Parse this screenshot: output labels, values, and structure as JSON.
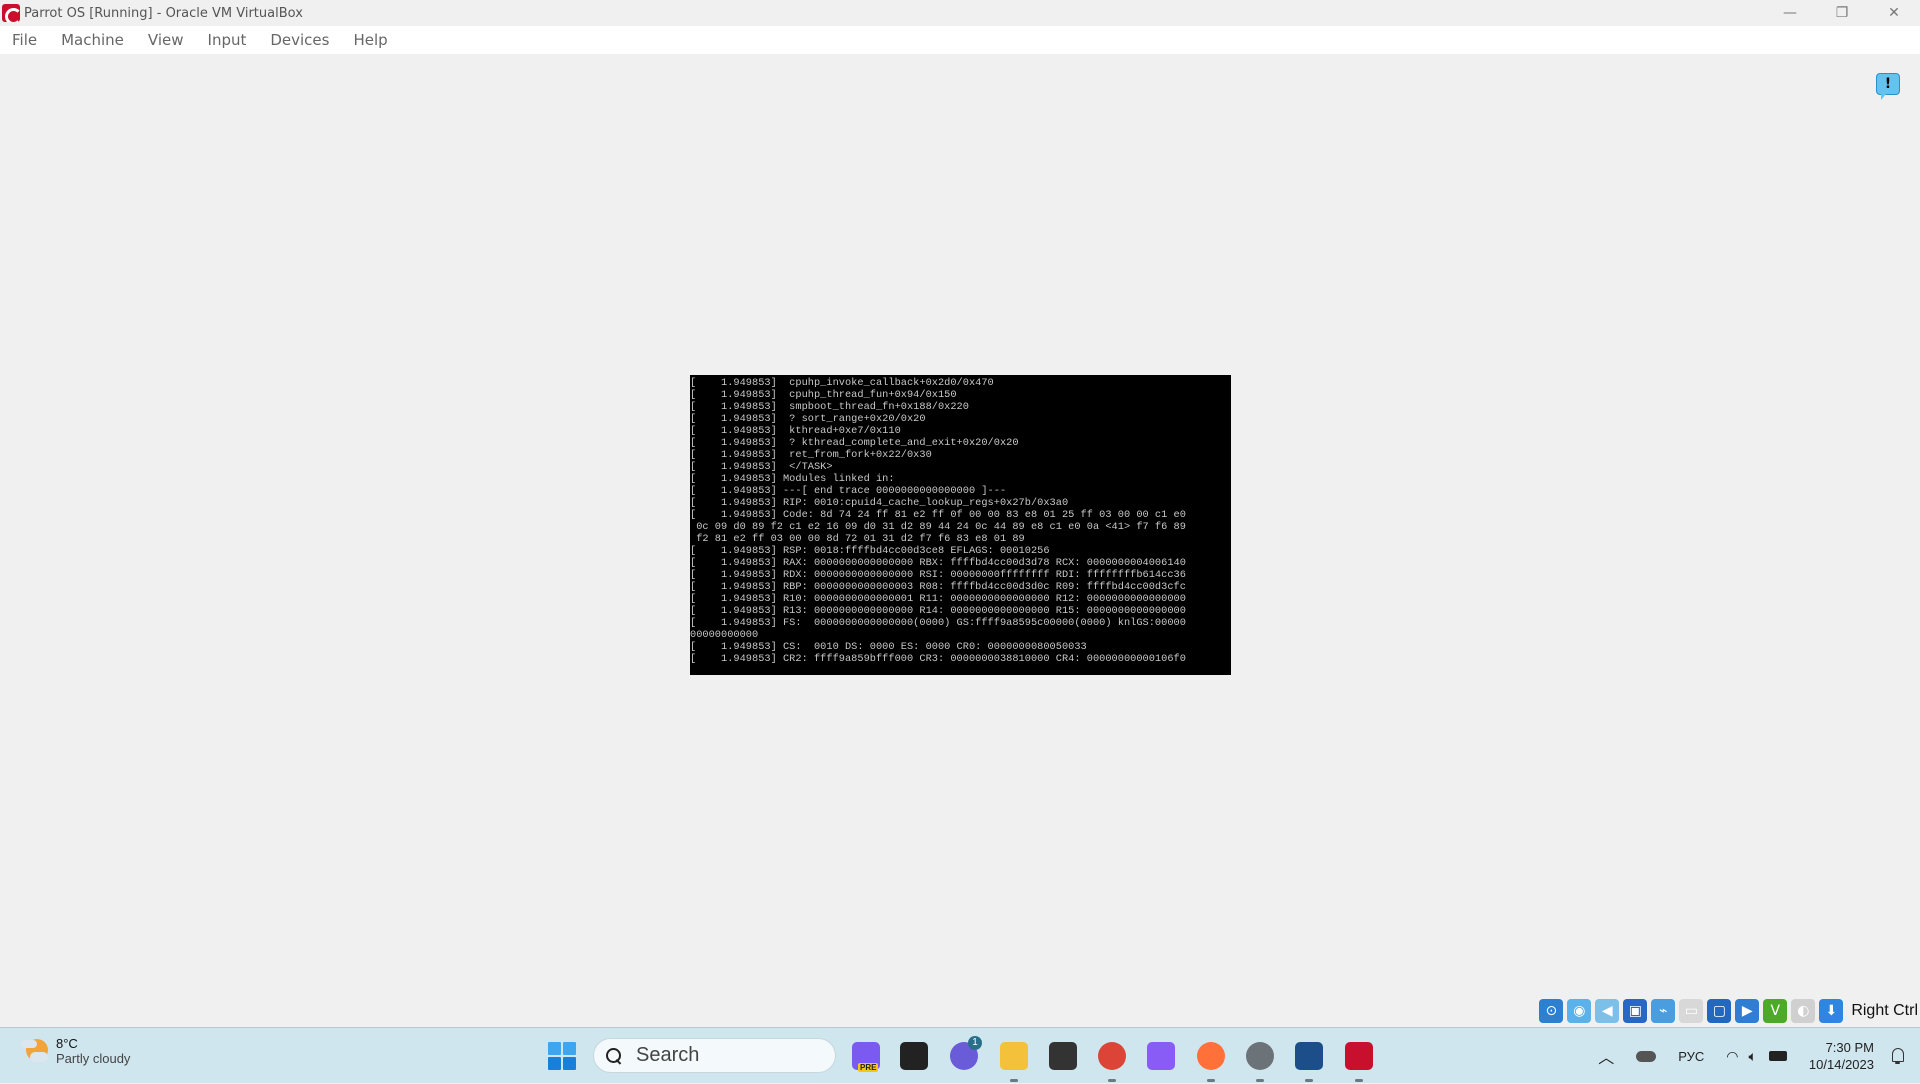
{
  "window": {
    "title": "Parrot OS [Running] - Oracle VM VirtualBox",
    "app_icon": "parrot-os-icon",
    "controls": [
      {
        "name": "minimize",
        "icon": "minimize-icon",
        "glyph": "—"
      },
      {
        "name": "restore",
        "icon": "restore-icon",
        "glyph": "❐"
      },
      {
        "name": "close",
        "icon": "close-icon",
        "glyph": "✕"
      }
    ]
  },
  "menu": {
    "items": [
      {
        "label": "File"
      },
      {
        "label": "Machine"
      },
      {
        "label": "View"
      },
      {
        "label": "Input"
      },
      {
        "label": "Devices"
      },
      {
        "label": "Help"
      }
    ]
  },
  "notification": {
    "icon": "notification-exclamation-icon",
    "glyph": "!"
  },
  "console": {
    "lines": [
      "[    1.949853]  cpuhp_invoke_callback+0x2d0/0x470",
      "[    1.949853]  cpuhp_thread_fun+0x94/0x150",
      "[    1.949853]  smpboot_thread_fn+0x188/0x220",
      "[    1.949853]  ? sort_range+0x20/0x20",
      "[    1.949853]  kthread+0xe7/0x110",
      "[    1.949853]  ? kthread_complete_and_exit+0x20/0x20",
      "[    1.949853]  ret_from_fork+0x22/0x30",
      "[    1.949853]  </TASK>",
      "[    1.949853] Modules linked in:",
      "[    1.949853] ---[ end trace 0000000000000000 ]---",
      "[    1.949853] RIP: 0010:cpuid4_cache_lookup_regs+0x27b/0x3a0",
      "[    1.949853] Code: 8d 74 24 ff 81 e2 ff 0f 00 00 83 e8 01 25 ff 03 00 00 c1 e0",
      " 0c 09 d0 89 f2 c1 e2 16 09 d0 31 d2 89 44 24 0c 44 89 e8 c1 e0 0a <41> f7 f6 89",
      " f2 81 e2 ff 03 00 00 8d 72 01 31 d2 f7 f6 83 e8 01 89",
      "[    1.949853] RSP: 0018:ffffbd4cc00d3ce8 EFLAGS: 00010256",
      "[    1.949853] RAX: 0000000000000000 RBX: ffffbd4cc00d3d78 RCX: 0000000004006140",
      "[    1.949853] RDX: 0000000000000000 RSI: 00000000ffffffff RDI: ffffffffb614cc36",
      "[    1.949853] RBP: 0000000000000003 R08: ffffbd4cc00d3d0c R09: ffffbd4cc00d3cfc",
      "[    1.949853] R10: 0000000000000001 R11: 0000000000000000 R12: 0000000000000000",
      "[    1.949853] R13: 0000000000000000 R14: 0000000000000000 R15: 0000000000000000",
      "[    1.949853] FS:  0000000000000000(0000) GS:ffff9a8595c00000(0000) knlGS:00000",
      "00000000000",
      "[    1.949853] CS:  0010 DS: 0000 ES: 0000 CR0: 0000000080050033",
      "[    1.949853] CR2: ffff9a859bfff000 CR3: 0000000038810000 CR4: 00000000000106f0"
    ]
  },
  "statusbar": {
    "icons": [
      {
        "name": "hard-disk-icon",
        "color": "#2d7fd0",
        "glyph": "⊙"
      },
      {
        "name": "optical-drive-icon",
        "color": "#5bb2ea",
        "glyph": "◉"
      },
      {
        "name": "audio-icon",
        "color": "#7cc0ea",
        "glyph": "◀"
      },
      {
        "name": "network-icon",
        "color": "#2668c4",
        "glyph": "▣"
      },
      {
        "name": "usb-icon",
        "color": "#4a9ee0",
        "glyph": "⌁"
      },
      {
        "name": "shared-folders-icon",
        "color": "#d8d8d8",
        "glyph": "▭"
      },
      {
        "name": "display-icon",
        "color": "#2368c0",
        "glyph": "▢"
      },
      {
        "name": "video-capture-icon",
        "color": "#2f7ed3",
        "glyph": "▶"
      },
      {
        "name": "cpu-execution-icon",
        "color": "#4caa28",
        "glyph": "V"
      },
      {
        "name": "mouse-integration-icon",
        "color": "#d0d0d0",
        "glyph": "◐"
      },
      {
        "name": "keyboard-capture-icon",
        "color": "#2f86e0",
        "glyph": "⬇"
      }
    ],
    "host_key": "Right Ctrl"
  },
  "taskbar": {
    "weather": {
      "temp": "8°C",
      "desc": "Partly cloudy",
      "icon": "weather-partly-cloudy-night-icon"
    },
    "start_icon": "windows-start-icon",
    "search_placeholder": "Search",
    "apps": [
      {
        "name": "copilot-icon",
        "badge": "PRE",
        "color": "#7a5af0"
      },
      {
        "name": "task-view-icon",
        "color": "#222"
      },
      {
        "name": "teams-chat-icon",
        "badge": "1",
        "color": "#6a5bd8"
      },
      {
        "name": "file-explorer-icon",
        "color": "#f3c13a",
        "running": true
      },
      {
        "name": "terminal-icon",
        "color": "#333"
      },
      {
        "name": "chrome-icon",
        "color": "#db4437",
        "running": true
      },
      {
        "name": "obsidian-icon",
        "color": "#8a5cf6"
      },
      {
        "name": "firefox-icon",
        "color": "#ff7139",
        "running": true
      },
      {
        "name": "settings-icon",
        "color": "#6b7379",
        "running": true
      },
      {
        "name": "virtualbox-icon",
        "color": "#1c4f8a",
        "running": true
      },
      {
        "name": "parrot-vm-icon",
        "color": "#c8102e",
        "running": true
      }
    ],
    "tray": {
      "chevron_icon": "show-hidden-icons-chevron",
      "onedrive_icon": "onedrive-cloud-icon",
      "language": "РУС",
      "wifi_icon": "wifi-icon",
      "volume_icon": "volume-icon",
      "battery_icon": "battery-charging-icon",
      "time": "7:30 PM",
      "date": "10/14/2023",
      "bell_icon": "notifications-bell-icon"
    }
  }
}
